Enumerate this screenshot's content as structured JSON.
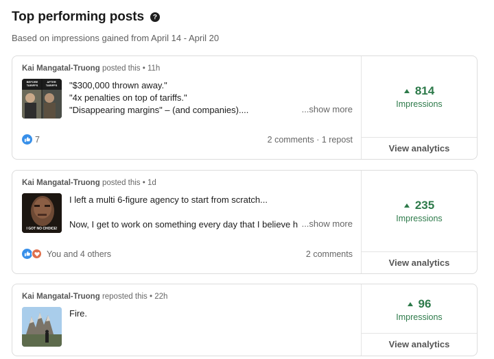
{
  "header": {
    "title": "Top performing posts",
    "help_icon": "?",
    "subtitle": "Based on impressions gained from April 14 - April 20"
  },
  "posts": [
    {
      "author": "Kai Mangatal-Truong",
      "action": "posted this",
      "time": "11h",
      "lines": [
        "\"$300,000 thrown away.\"",
        "\"4x penalties on top of tariffs.\"",
        "\"Disappearing margins\" – (and companies)...."
      ],
      "show_more": "...show more",
      "thumb_text_left": "BEFORE TARIFFS",
      "thumb_text_right": "AFTER TARIFFS",
      "reactions_text": "7",
      "engagement": "2 comments · 1 repost",
      "impressions": "814",
      "impressions_label": "Impressions",
      "analytics_label": "View analytics"
    },
    {
      "author": "Kai Mangatal-Truong",
      "action": "posted this",
      "time": "1d",
      "lines": [
        "I left a multi 6-figure agency to start from scratch...",
        "",
        "Now, I get to work on something every day that I believe h"
      ],
      "show_more": "...show more",
      "thumb_caption": "I GOT NO CHOICE!",
      "reactions_text": "You and 4 others",
      "engagement": "2 comments",
      "impressions": "235",
      "impressions_label": "Impressions",
      "analytics_label": "View analytics"
    },
    {
      "author": "Kai Mangatal-Truong",
      "action": "reposted this",
      "time": "22h",
      "lines": [
        "Fire."
      ],
      "impressions": "96",
      "impressions_label": "Impressions",
      "analytics_label": "View analytics"
    }
  ],
  "colors": {
    "accent_green": "#2d7a4a",
    "like_blue": "#378fe9",
    "love_orange": "#df704d"
  },
  "icons": {
    "help": "question-circle-icon",
    "like": "thumbs-up-reaction-icon",
    "love": "heart-reaction-icon",
    "up": "triangle-up-icon"
  }
}
